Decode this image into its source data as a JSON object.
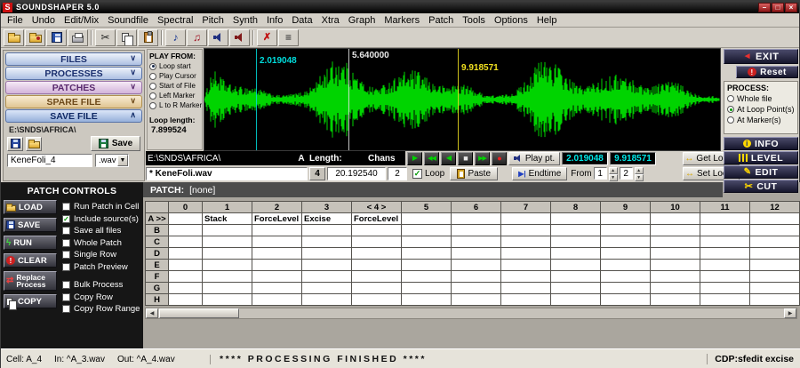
{
  "window": {
    "title": "SOUNDSHAPER 5.0",
    "logo_letter": "S"
  },
  "menu": {
    "items": [
      "File",
      "Undo",
      "Edit/Mix",
      "Soundfile",
      "Spectral",
      "Pitch",
      "Synth",
      "Info",
      "Data",
      "Xtra",
      "Graph",
      "Markers",
      "Patch",
      "Tools",
      "Options",
      "Help"
    ]
  },
  "toolbar": {
    "icons": [
      "open-file-icon",
      "open-folder-icon",
      "save-file-icon",
      "print-icon",
      "cut-icon",
      "copy-icon",
      "paste-icon",
      "play-note-icon",
      "music-notes-icon",
      "speaker-icon",
      "loud-speaker-icon",
      "mute-icon",
      "process-list-icon"
    ]
  },
  "left_panel": {
    "sections": [
      {
        "label": "FILES"
      },
      {
        "label": "PROCESSES"
      },
      {
        "label": "PATCHES"
      },
      {
        "label": "SPARE FILE"
      },
      {
        "label": "SAVE FILE"
      }
    ],
    "save_file": {
      "path": "E:\\SNDS\\AFRICA\\",
      "save_label": "Save",
      "filename": "KeneFoli_4",
      "ext": ".wav"
    }
  },
  "play_from": {
    "title": "PLAY FROM:",
    "options": [
      "Loop start",
      "Play Cursor",
      "Start of File",
      "Left Marker",
      "L to R Marker"
    ],
    "selected": 0,
    "loop_length_label": "Loop length:",
    "loop_length": "7.899524"
  },
  "waveform": {
    "markers": [
      {
        "time": "2.019048",
        "color": "#00dcdc"
      },
      {
        "time": "5.640000",
        "color": "#e8e8e8"
      },
      {
        "time": "9.918571",
        "color": "#f0e020"
      }
    ],
    "wave_color": "#00d400",
    "background": "#000000"
  },
  "right_panel": {
    "exit_label": "EXIT",
    "reset_label": "Reset",
    "process": {
      "title": "PROCESS:",
      "options": [
        "Whole file",
        "At Loop Point(s)",
        "At Marker(s)"
      ],
      "selected": 1
    },
    "buttons": [
      "INFO",
      "LEVEL",
      "EDIT",
      "CUT"
    ]
  },
  "file_bar": {
    "path": "E:\\SNDS\\AFRICA\\",
    "slot_label": "A",
    "length_label": "Length:",
    "chans_label": "Chans",
    "filename": "* KeneFoli.wav",
    "slot_num": "4",
    "length": "20.192540",
    "chans": "2",
    "loop_label": "Loop",
    "loop_checked": true,
    "paste_label": "Paste",
    "play_pt_label": "Play pt.",
    "play_start": "2.019048",
    "play_end": "9.918571",
    "get_loops_label": "Get Loops",
    "set_loops_label": "Set Loops",
    "endtime_label": "Endtime",
    "from_label": "From",
    "from_value": "1",
    "to_value": "2"
  },
  "patch_controls": {
    "title": "PATCH CONTROLS",
    "buttons": [
      "LOAD",
      "SAVE",
      "RUN",
      "CLEAR",
      "Replace Process",
      "COPY"
    ],
    "checkboxes_top": [
      {
        "label": "Run Patch in Cell",
        "checked": false
      },
      {
        "label": "Include source(s)",
        "checked": true
      },
      {
        "label": "Save all files",
        "checked": false
      },
      {
        "label": "Whole Patch",
        "checked": false
      },
      {
        "label": "Single Row",
        "checked": false
      },
      {
        "label": "Patch Preview",
        "checked": false
      }
    ],
    "checkboxes_bottom": [
      {
        "label": "Bulk Process",
        "checked": false
      },
      {
        "label": "Copy Row",
        "checked": false
      },
      {
        "label": "Copy Row Range",
        "checked": false
      }
    ]
  },
  "patch_grid": {
    "header_label": "PATCH:",
    "header_value": "[none]",
    "columns": [
      "0",
      "1",
      "2",
      "3",
      "< 4 >",
      "5",
      "6",
      "7",
      "8",
      "9",
      "10",
      "11",
      "12"
    ],
    "rows": [
      {
        "label": "A >>",
        "cells": {
          "1": "Stack",
          "2": "ForceLevel",
          "3": "Excise",
          "4": "ForceLevel"
        }
      },
      {
        "label": "B",
        "cells": {}
      },
      {
        "label": "C",
        "cells": {}
      },
      {
        "label": "D",
        "cells": {}
      },
      {
        "label": "E",
        "cells": {}
      },
      {
        "label": "F",
        "cells": {}
      },
      {
        "label": "G",
        "cells": {}
      },
      {
        "label": "H",
        "cells": {}
      }
    ]
  },
  "status_bar": {
    "cell": "Cell: A_4",
    "in": "In: ^A_3.wav",
    "out": "Out: ^A_4.wav",
    "message": "**** PROCESSING FINISHED ****",
    "right": "CDP:sfedit excise"
  }
}
